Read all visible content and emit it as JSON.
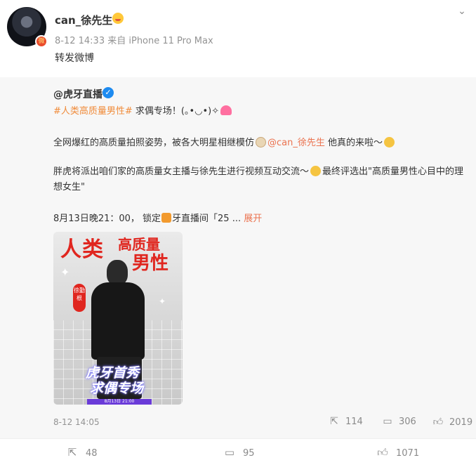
{
  "post": {
    "username": "can_徐先生",
    "meta": "8-12 14:33  来自 iPhone 11 Pro Max",
    "repost_text": "转发微博",
    "user_emoji_icon": "smiling-face-icon",
    "avatar_badge_icon": "weibo-badge-icon"
  },
  "original": {
    "author": "@虎牙直播",
    "hashtag": "#人类高质量男性#",
    "line1_rest": " 求偶专场！(｡•◡•)✧",
    "line2_pre": "全网爆红的高质量拍照姿势，被各大明星相继模仿",
    "mention": "@can_徐先生",
    "line2_post": " 他真的来啦～",
    "line3_pre": "胖虎将派出咱们家的高质量女主播与徐先生进行视频互动交流～",
    "line3_post": "最终评选出\"高质量男性心目中的理想女生\"",
    "line4_pre": "8月13日晚21：00， 锁定",
    "line4_mid": "牙直播间「25 ... ",
    "expand": "展开",
    "poster": {
      "title_a": "人类",
      "title_b": "高质量",
      "title_c": "男性",
      "tag": "徐勤根",
      "bottom_1": "虎牙首秀",
      "bottom_2": "求偶专场",
      "strip": "8月13日 21:00"
    },
    "time": "8-12 14:05",
    "reposts": "114",
    "comments": "306",
    "likes": "2019"
  },
  "toolbar": {
    "reposts": "48",
    "comments": "95",
    "likes": "1071"
  },
  "colors": {
    "accent": "#eb7350",
    "hashtag": "#f08b3a",
    "verified": "#1e8bf0",
    "muted": "#939393"
  }
}
